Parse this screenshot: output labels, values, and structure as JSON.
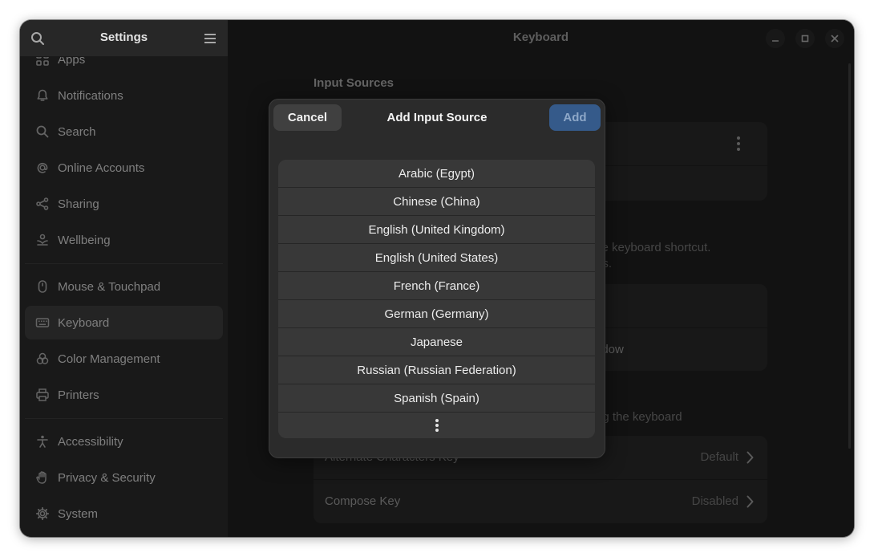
{
  "sidebar": {
    "title": "Settings",
    "items": [
      {
        "label": "Apps",
        "icon": "apps-icon"
      },
      {
        "label": "Notifications",
        "icon": "bell-icon"
      },
      {
        "label": "Search",
        "icon": "search-icon"
      },
      {
        "label": "Online Accounts",
        "icon": "at-icon"
      },
      {
        "label": "Sharing",
        "icon": "share-icon"
      },
      {
        "label": "Wellbeing",
        "icon": "wellbeing-icon"
      },
      {
        "label": "Mouse & Touchpad",
        "icon": "mouse-icon"
      },
      {
        "label": "Keyboard",
        "icon": "keyboard-icon",
        "selected": true
      },
      {
        "label": "Color Management",
        "icon": "color-icon"
      },
      {
        "label": "Printers",
        "icon": "printer-icon"
      },
      {
        "label": "Accessibility",
        "icon": "accessibility-icon"
      },
      {
        "label": "Privacy & Security",
        "icon": "hand-icon"
      },
      {
        "label": "System",
        "icon": "gear-icon"
      }
    ]
  },
  "content": {
    "title": "Keyboard",
    "input_sources_heading": "Input Sources",
    "switching_desc_line1": "ce keyboard shortcut.",
    "switching_desc_line2": "gs.",
    "window_row_fragment": "ndow",
    "special_char_desc_fragment": "ng the keyboard",
    "alt_chars_label": "Alternate Characters Key",
    "alt_chars_value": "Default",
    "compose_label": "Compose Key",
    "compose_value": "Disabled"
  },
  "dialog": {
    "cancel_label": "Cancel",
    "title": "Add Input Source",
    "add_label": "Add",
    "languages": [
      "Arabic (Egypt)",
      "Chinese (China)",
      "English (United Kingdom)",
      "English (United States)",
      "French (France)",
      "German (Germany)",
      "Japanese",
      "Russian (Russian Federation)",
      "Spanish (Spain)"
    ],
    "more_icon": "more-vertical-icon"
  },
  "colors": {
    "accent": "#355a8a",
    "window_bg": "#1d1d1d",
    "sidebar_bg": "#272727",
    "dialog_bg": "#2b2b2b",
    "list_row_bg": "#383838"
  }
}
